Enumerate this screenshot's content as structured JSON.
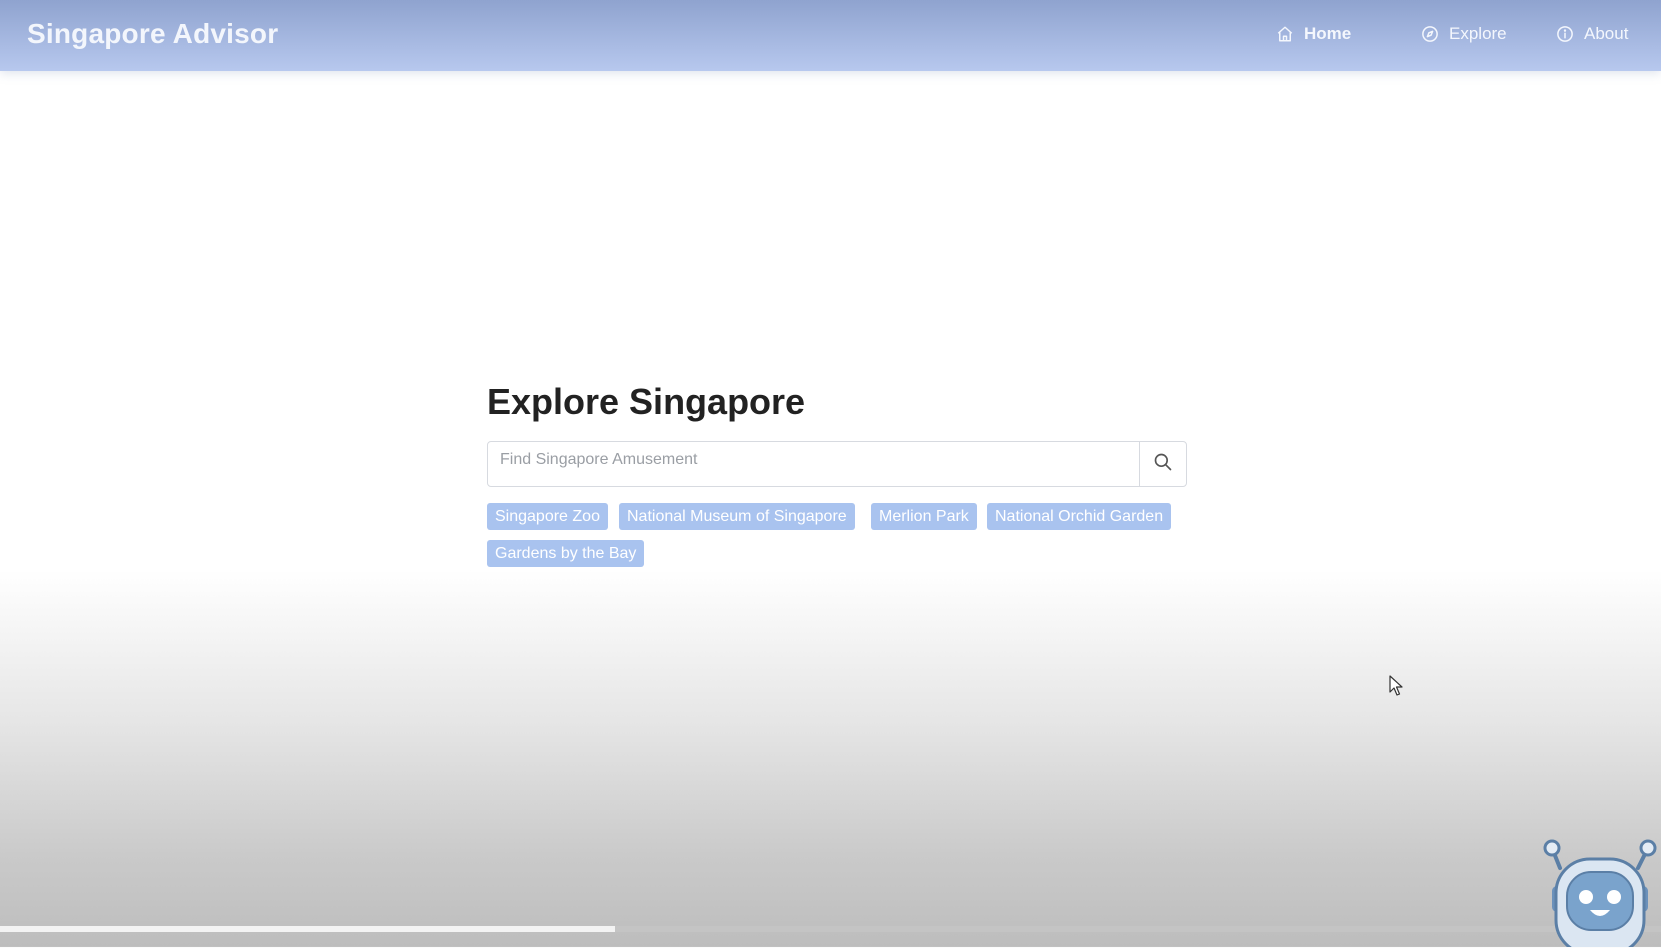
{
  "header": {
    "brand": "Singapore Advisor",
    "nav": [
      {
        "label": "Home",
        "icon": "home-icon"
      },
      {
        "label": "Explore",
        "icon": "compass-icon"
      },
      {
        "label": "About",
        "icon": "info-icon"
      }
    ]
  },
  "main": {
    "title": "Explore Singapore",
    "search": {
      "placeholder": "Find Singapore Amusement",
      "value": ""
    },
    "tags": [
      "Singapore Zoo",
      "National Museum of Singapore",
      "Merlion Park",
      "National Orchid Garden",
      "Gardens by the Bay"
    ]
  },
  "colors": {
    "navbar_top": "#8fa3cf",
    "navbar_bottom": "#b7c8ee",
    "tag_bg": "#a9c3ef",
    "title": "#222222"
  },
  "icons": [
    "home-icon",
    "compass-icon",
    "info-icon",
    "search-icon",
    "chatbot-robot-icon",
    "mouse-cursor-icon"
  ]
}
